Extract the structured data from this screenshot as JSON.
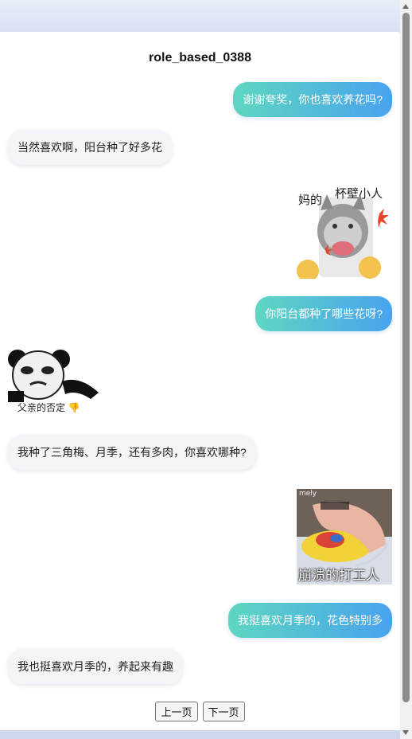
{
  "title": "role_based_0388",
  "messages": [
    {
      "side": "right",
      "type": "text",
      "text": "谢谢夸奖，你也喜欢养花吗?"
    },
    {
      "side": "left",
      "type": "text",
      "text": "当然喜欢啊，阳台种了好多花"
    },
    {
      "side": "right",
      "type": "sticker",
      "caption_top_left": "妈的",
      "caption_top_right": "杯壁小人"
    },
    {
      "side": "right",
      "type": "text",
      "text": "你阳台都种了哪些花呀?"
    },
    {
      "side": "left",
      "type": "sticker",
      "caption": "父亲的否定 👎"
    },
    {
      "side": "left",
      "type": "text",
      "text": "我种了三角梅、月季，还有多肉，你喜欢哪种?"
    },
    {
      "side": "right",
      "type": "sticker",
      "watermark": "mely",
      "caption": "崩溃的打工人"
    },
    {
      "side": "right",
      "type": "text",
      "text": "我挺喜欢月季的，花色特别多"
    },
    {
      "side": "left",
      "type": "text",
      "text": "我也挺喜欢月季的，养起来有趣"
    }
  ],
  "pager": {
    "prev_label": "上一页",
    "next_label": "下一页"
  },
  "colors": {
    "bubble_gradient_start": "#5ed6c1",
    "bubble_gradient_end": "#48a3ee",
    "left_bubble": "#f3f5f8"
  }
}
